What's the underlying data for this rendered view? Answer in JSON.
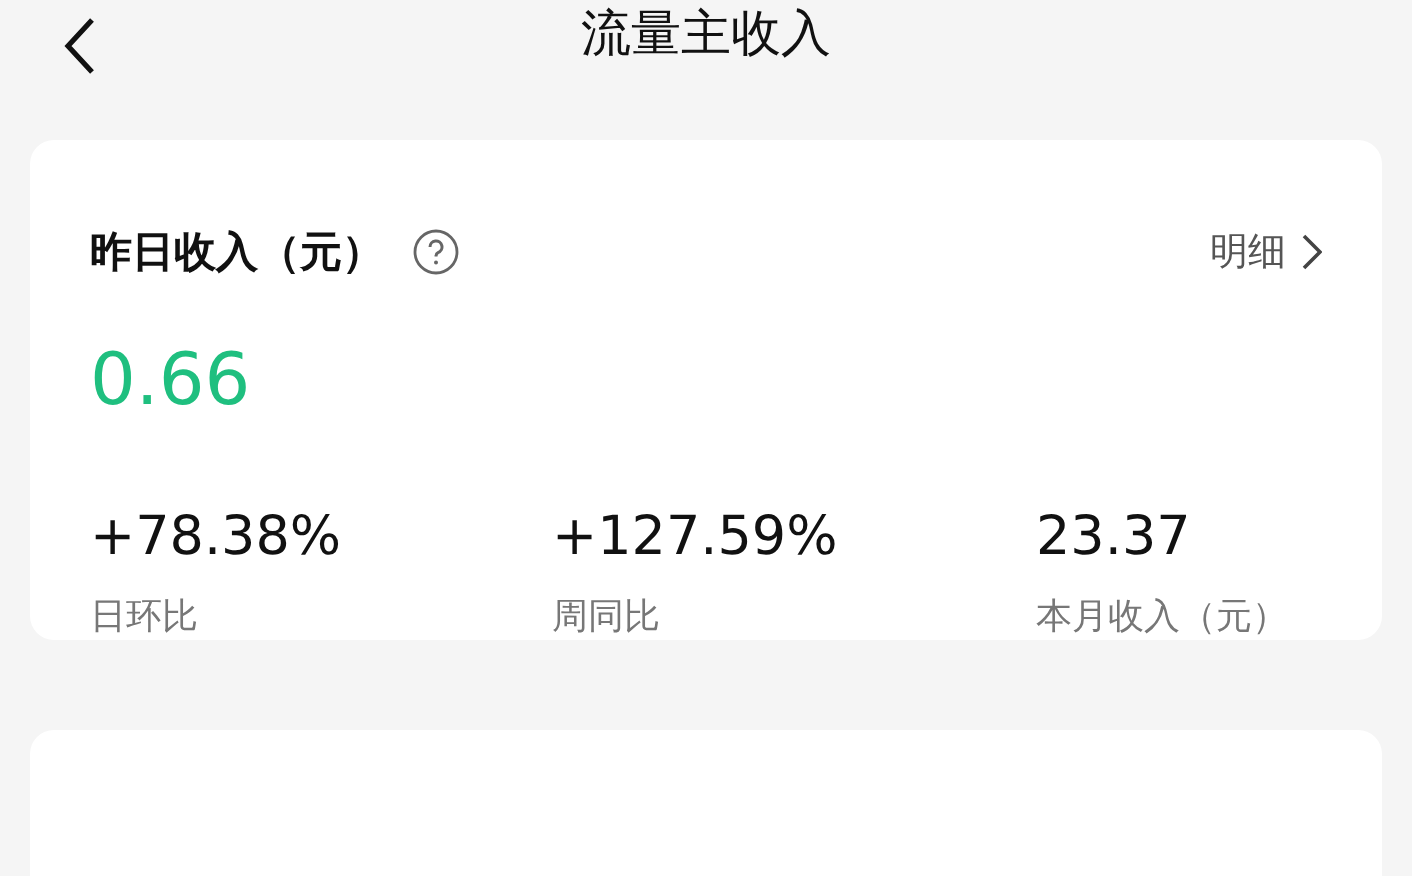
{
  "header": {
    "title": "流量主收入"
  },
  "income_card": {
    "title": "昨日收入（元）",
    "detail_link": "明细",
    "amount": "0.66",
    "stats": [
      {
        "value": "+78.38%",
        "label": "日环比"
      },
      {
        "value": "+127.59%",
        "label": "周同比"
      },
      {
        "value": "23.37",
        "label": "本月收入（元）"
      }
    ]
  }
}
